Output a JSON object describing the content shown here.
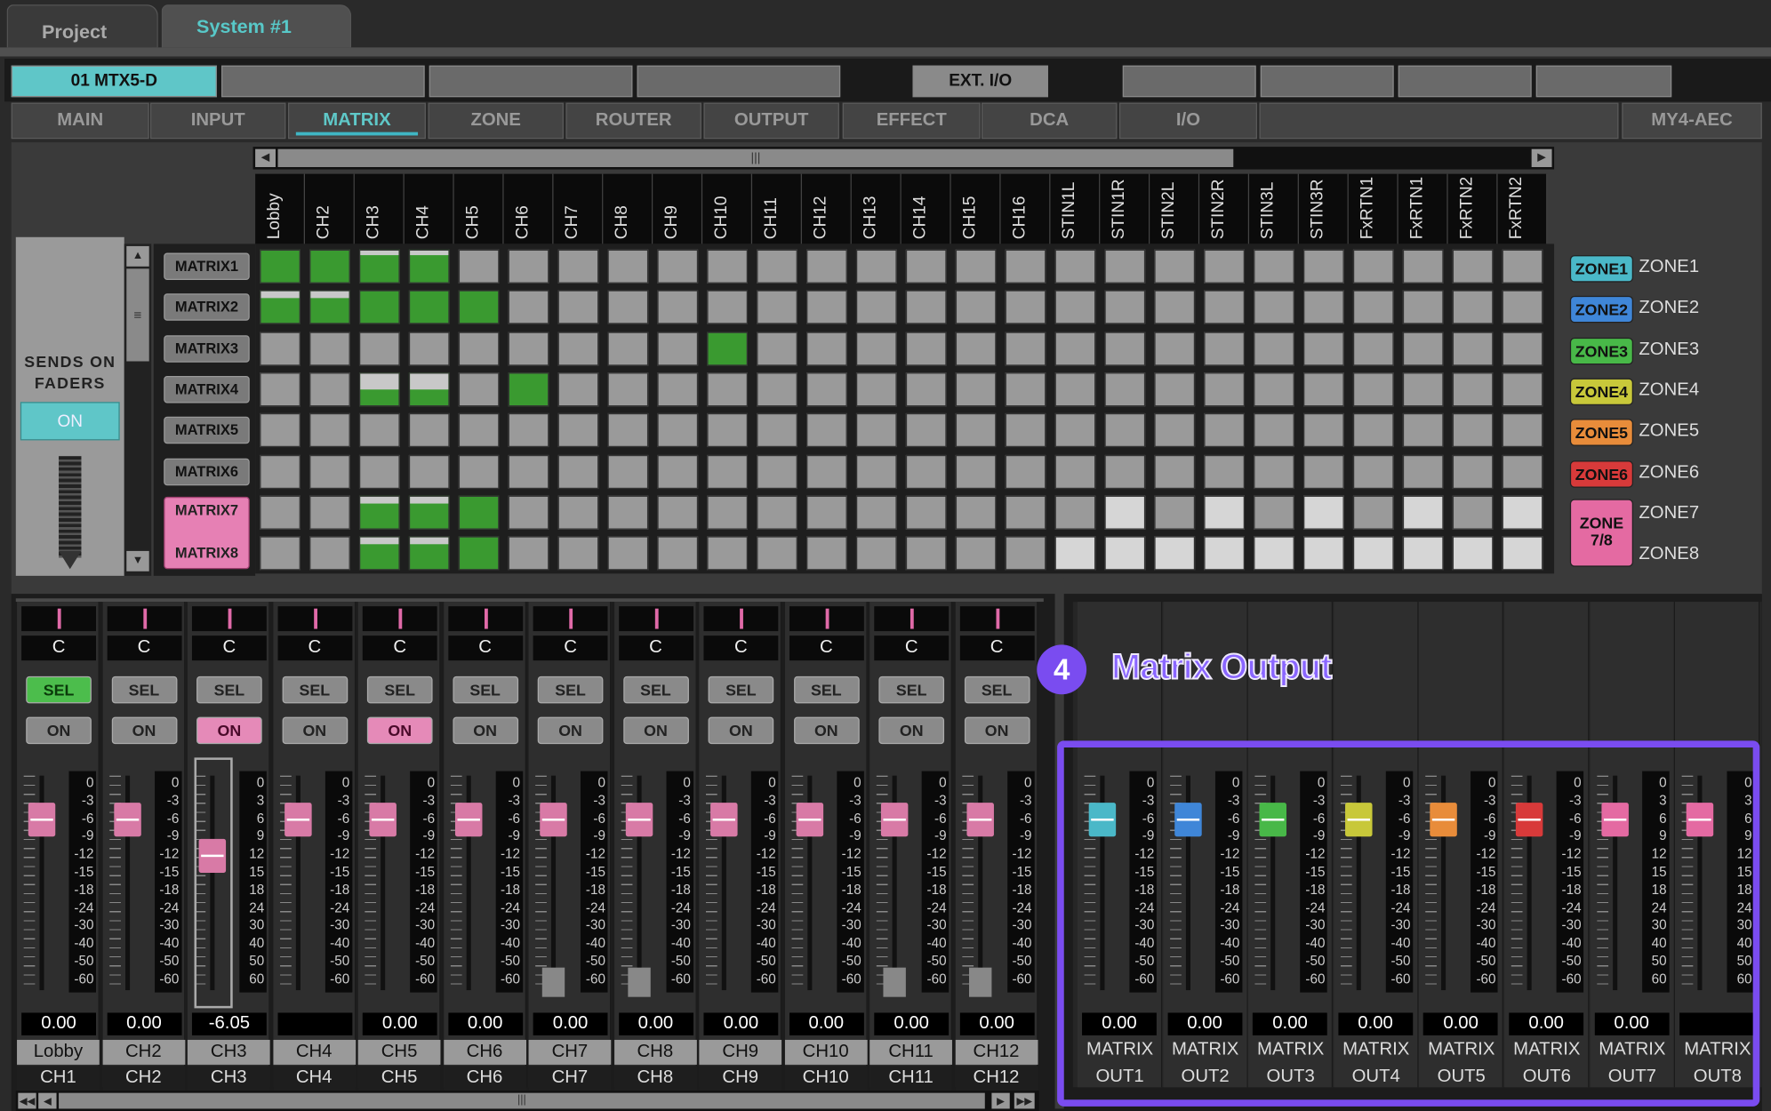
{
  "top_tabs": [
    "Project",
    "System #1"
  ],
  "device_tabs": {
    "active": "01 MTX5-D",
    "ext": "EXT. I/O"
  },
  "nav_tabs": [
    "MAIN",
    "INPUT",
    "MATRIX",
    "ZONE",
    "ROUTER",
    "OUTPUT",
    "EFFECT",
    "DCA",
    "I/O",
    "MY4-AEC"
  ],
  "matrix_columns": [
    "Lobby",
    "CH2",
    "CH3",
    "CH4",
    "CH5",
    "CH6",
    "CH7",
    "CH8",
    "CH9",
    "CH10",
    "CH11",
    "CH12",
    "CH13",
    "CH14",
    "CH15",
    "CH16",
    "STIN1L",
    "STIN1R",
    "STIN2L",
    "STIN2R",
    "STIN3L",
    "STIN3R",
    "FxRTN1",
    "FxRTN1",
    "FxRTN2",
    "FxRTN2"
  ],
  "matrix_rows": [
    "MATRIX1",
    "MATRIX2",
    "MATRIX3",
    "MATRIX4",
    "MATRIX5",
    "MATRIX6",
    "MATRIX7",
    "MATRIX8"
  ],
  "zones": [
    {
      "badge": "ZONE1",
      "label": "ZONE1",
      "color": "#4ab8c8"
    },
    {
      "badge": "ZONE2",
      "label": "ZONE2",
      "color": "#3f86d8"
    },
    {
      "badge": "ZONE3",
      "label": "ZONE3",
      "color": "#48b848"
    },
    {
      "badge": "ZONE4",
      "label": "ZONE4",
      "color": "#c8c83a"
    },
    {
      "badge": "ZONE5",
      "label": "ZONE5",
      "color": "#e88c3a"
    },
    {
      "badge": "ZONE6",
      "label": "ZONE6",
      "color": "#d83a3a"
    },
    {
      "label": "ZONE7"
    },
    {
      "label": "ZONE8"
    }
  ],
  "zone78": {
    "line1": "ZONE",
    "line2": "7/8",
    "color": "#e46aa2"
  },
  "sends": {
    "title1": "SENDS ON",
    "title2": "FADERS",
    "button": "ON"
  },
  "channel_scale": [
    "0",
    "3",
    "6",
    "9",
    "12",
    "15",
    "18",
    "24",
    "30",
    "40",
    "50",
    "60"
  ],
  "channel_scale_neg": [
    "0",
    "-3",
    "-6",
    "-9",
    "-12",
    "-15",
    "-18",
    "-24",
    "-30",
    "-40",
    "-50",
    "-60"
  ],
  "channels": [
    {
      "c": "C",
      "sel": "SEL",
      "on": "ON",
      "gain": "0.00",
      "l1": "Lobby",
      "l2": "CH1",
      "sel_on": true,
      "on_on": false
    },
    {
      "c": "C",
      "sel": "SEL",
      "on": "ON",
      "gain": "0.00",
      "l1": "CH2",
      "l2": "CH2",
      "sel_on": false,
      "on_on": false
    },
    {
      "c": "C",
      "sel": "SEL",
      "on": "ON",
      "gain": "-6.05",
      "l1": "CH3",
      "l2": "CH3",
      "sel_on": false,
      "on_on": true
    },
    {
      "c": "C",
      "sel": "SEL",
      "on": "ON",
      "gain": "",
      "l1": "CH4",
      "l2": "CH4",
      "sel_on": false,
      "on_on": false
    },
    {
      "c": "C",
      "sel": "SEL",
      "on": "ON",
      "gain": "0.00",
      "l1": "CH5",
      "l2": "CH5",
      "sel_on": false,
      "on_on": true
    },
    {
      "c": "C",
      "sel": "SEL",
      "on": "ON",
      "gain": "0.00",
      "l1": "CH6",
      "l2": "CH6",
      "sel_on": false,
      "on_on": false
    },
    {
      "c": "C",
      "sel": "SEL",
      "on": "ON",
      "gain": "0.00",
      "l1": "CH7",
      "l2": "CH7",
      "sel_on": false,
      "on_on": false
    },
    {
      "c": "C",
      "sel": "SEL",
      "on": "ON",
      "gain": "0.00",
      "l1": "CH8",
      "l2": "CH8",
      "sel_on": false,
      "on_on": false
    },
    {
      "c": "C",
      "sel": "SEL",
      "on": "ON",
      "gain": "0.00",
      "l1": "CH9",
      "l2": "CH9",
      "sel_on": false,
      "on_on": false
    },
    {
      "c": "C",
      "sel": "SEL",
      "on": "ON",
      "gain": "0.00",
      "l1": "CH10",
      "l2": "CH10",
      "sel_on": false,
      "on_on": false
    },
    {
      "c": "C",
      "sel": "SEL",
      "on": "ON",
      "gain": "0.00",
      "l1": "CH11",
      "l2": "CH11",
      "sel_on": false,
      "on_on": false
    },
    {
      "c": "C",
      "sel": "SEL",
      "on": "ON",
      "gain": "0.00",
      "l1": "CH12",
      "l2": "CH12",
      "sel_on": false,
      "on_on": false
    }
  ],
  "callout": {
    "number": "4",
    "text": "Matrix Output",
    "color": "#7a4cf0"
  },
  "outputs": [
    {
      "gain": "0.00",
      "l1": "MATRIX",
      "l2": "OUT1",
      "color": "#4ab8c8"
    },
    {
      "gain": "0.00",
      "l1": "MATRIX",
      "l2": "OUT2",
      "color": "#3f86d8"
    },
    {
      "gain": "0.00",
      "l1": "MATRIX",
      "l2": "OUT3",
      "color": "#48b848"
    },
    {
      "gain": "0.00",
      "l1": "MATRIX",
      "l2": "OUT4",
      "color": "#c8c83a"
    },
    {
      "gain": "0.00",
      "l1": "MATRIX",
      "l2": "OUT5",
      "color": "#e88c3a"
    },
    {
      "gain": "0.00",
      "l1": "MATRIX",
      "l2": "OUT6",
      "color": "#d83a3a"
    },
    {
      "gain": "0.00",
      "l1": "MATRIX",
      "l2": "OUT7",
      "color": "#e46aa2"
    },
    {
      "gain": "",
      "l1": "MATRIX",
      "l2": "OUT8",
      "color": "#e46aa2"
    }
  ],
  "output_scale_a": [
    "0",
    "-3",
    "-6",
    "-9",
    "-12",
    "-15",
    "-18",
    "-24",
    "-30",
    "-40",
    "-50",
    "-60"
  ],
  "output_scale_b": [
    "0",
    "3",
    "6",
    "9",
    "12",
    "15",
    "18",
    "24",
    "30",
    "40",
    "50",
    "60"
  ]
}
